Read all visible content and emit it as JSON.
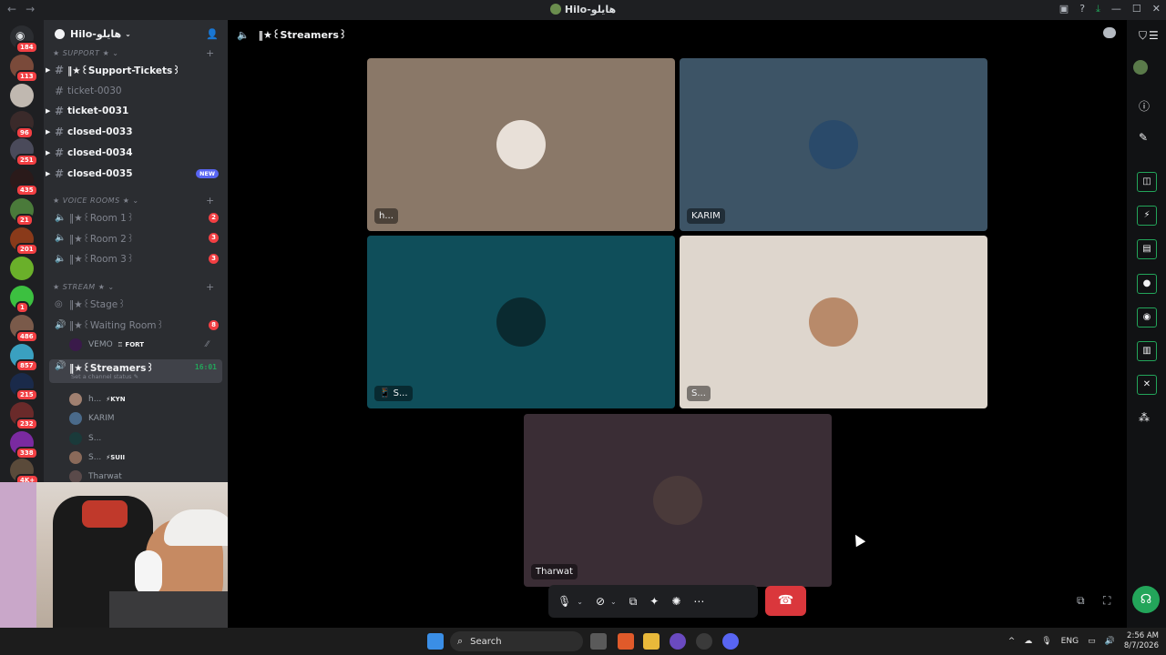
{
  "window": {
    "title": "Hilo-هايلو",
    "nav_back": "←",
    "nav_forward": "→"
  },
  "rail": {
    "home_badge": "184",
    "servers": [
      {
        "badge": "113",
        "color": "#7a4a3a"
      },
      {
        "badge": "",
        "color": "#c0b8b0"
      },
      {
        "badge": "96",
        "color": "#3a2a2a"
      },
      {
        "badge": "251",
        "color": "#4a4a5a"
      },
      {
        "badge": "435",
        "color": "#2a1a1a"
      },
      {
        "badge": "21",
        "color": "#4a7a3a"
      },
      {
        "badge": "201",
        "color": "#8a3a1a"
      },
      {
        "badge": "",
        "color": "#6ab02a"
      },
      {
        "badge": "1",
        "color": "#3cc040"
      },
      {
        "badge": "486",
        "color": "#7a5a4a"
      },
      {
        "badge": "857",
        "color": "#3aa0c0"
      },
      {
        "badge": "215",
        "color": "#1a2a4a"
      },
      {
        "badge": "232",
        "color": "#6a2a2a"
      },
      {
        "badge": "338",
        "color": "#7a2aa0"
      },
      {
        "badge": "4K+",
        "color": "#5a4a3a"
      }
    ]
  },
  "sidebar": {
    "server_name": "Hilo-هايلو",
    "categories": {
      "support": "★ SUPPORT ★",
      "voice": "★ VOICE ROOMS ★",
      "stream": "★ STREAM ★"
    },
    "text_channels": [
      {
        "name": "‖★꒰Support-Tickets꒱",
        "bright": true,
        "caret": true
      },
      {
        "name": "ticket-0030",
        "bright": false,
        "caret": false
      },
      {
        "name": "ticket-0031",
        "bright": true,
        "caret": true
      },
      {
        "name": "closed-0033",
        "bright": true,
        "caret": true
      },
      {
        "name": "closed-0034",
        "bright": true,
        "caret": true
      },
      {
        "name": "closed-0035",
        "bright": true,
        "caret": true,
        "new": "NEW"
      }
    ],
    "voice_channels": [
      {
        "name": "‖★꒰Room 1꒱",
        "count": "2"
      },
      {
        "name": "‖★꒰Room 2꒱",
        "count": "3"
      },
      {
        "name": "‖★꒰Room 3꒱",
        "count": "3"
      }
    ],
    "stage": "‖★꒰Stage꒱",
    "waiting_room": {
      "name": "‖★꒰Waiting Room꒱",
      "count": "8"
    },
    "waiting_user": {
      "name": "VEMO",
      "tag": "FORT"
    },
    "streamers": {
      "name": "‖★꒰Streamers꒱",
      "timer": "16:01",
      "status": "Set a channel status"
    },
    "streamers_users": [
      {
        "name": "h...",
        "tag": "⚡KYN",
        "color": "#a08070"
      },
      {
        "name": "KARIM",
        "tag": "",
        "color": "#4a6a8a"
      },
      {
        "name": "S...",
        "tag": "",
        "color": "#1a3a3a"
      },
      {
        "name": "S...",
        "tag": "⚡SUII",
        "color": "#8a6a5a"
      },
      {
        "name": "Tharwat",
        "tag": "",
        "color": "#5a4a4a"
      }
    ]
  },
  "call": {
    "channel": "‖★꒰Streamers꒱",
    "tiles": [
      {
        "label": "h...",
        "bg": "#8a7868",
        "avatar": "#e8e0d8"
      },
      {
        "label": "KARIM",
        "bg": "#3d5466",
        "avatar": "#2a4a6a"
      },
      {
        "label": "📱 S...",
        "bg": "#0f4e5a",
        "avatar": "#0a2a30"
      },
      {
        "label": "S...",
        "bg": "#ded6cd",
        "avatar": "#b88a6a"
      },
      {
        "label": "Tharwat",
        "bg": "#3a2d35",
        "avatar": "#4a3a3a"
      }
    ],
    "controls": {
      "mic": "🎙",
      "chevron": "⌄",
      "camera": "⊘",
      "share": "⧉",
      "activities": "✦",
      "soundboard": "✺",
      "more": "⋯",
      "leave": "☎"
    }
  },
  "taskbar": {
    "search_placeholder": "Search",
    "lang": "ENG",
    "time": "2:56 AM",
    "date": "8/7/2026"
  }
}
